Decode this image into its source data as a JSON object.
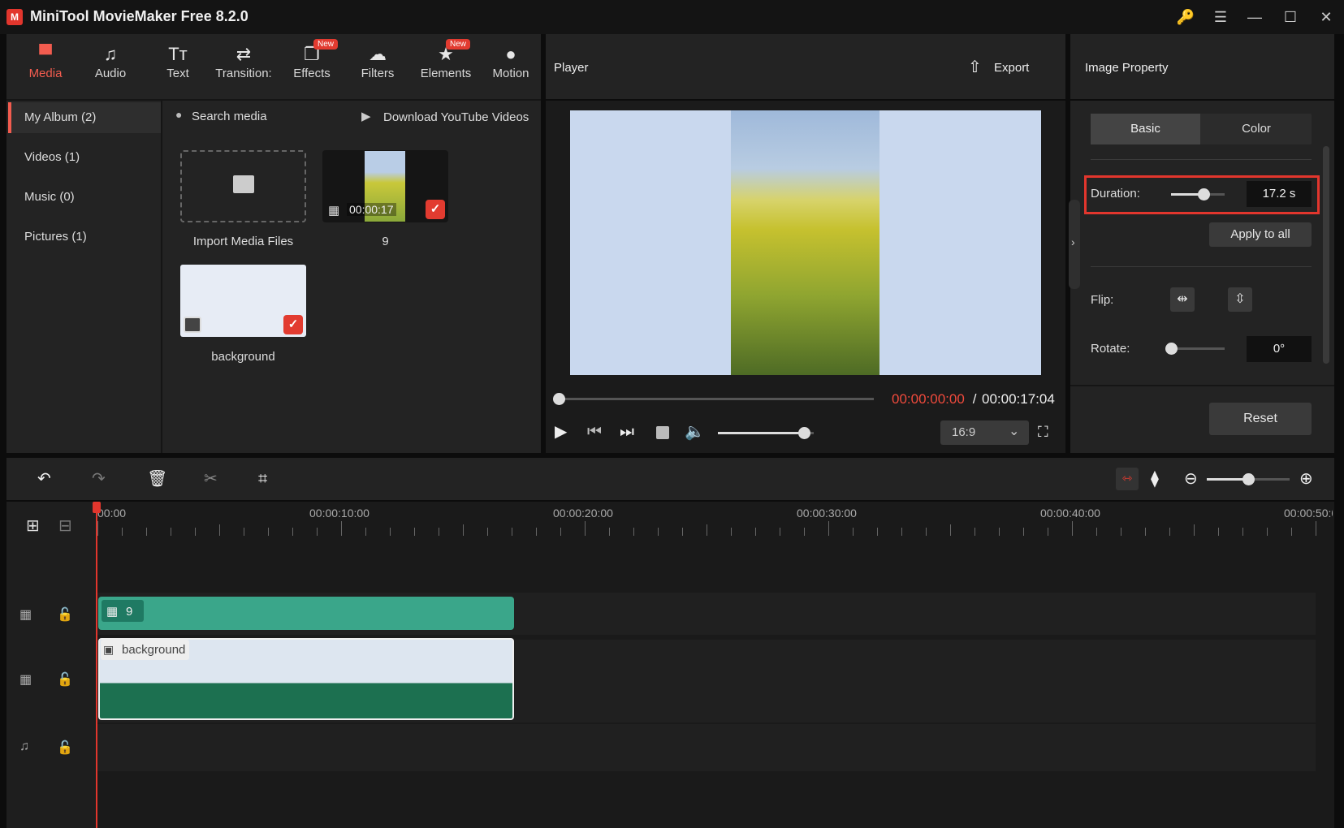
{
  "app": {
    "title": "MiniTool MovieMaker Free 8.2.0",
    "logo": "M"
  },
  "window_controls": {
    "key": "🔑",
    "menu": "☰",
    "minimize": "—",
    "maximize": "☐",
    "close": "✕"
  },
  "toolbar": {
    "items": [
      {
        "label": "Media",
        "icon": "media-icon",
        "glyph": "▀"
      },
      {
        "label": "Audio",
        "icon": "music-note-icon",
        "glyph": "♫"
      },
      {
        "label": "Text",
        "icon": "text-icon",
        "glyph": "Tт"
      },
      {
        "label": "Transition:",
        "icon": "transition-icon",
        "glyph": "⇄"
      },
      {
        "label": "Effects",
        "icon": "effects-icon",
        "glyph": "❐",
        "badge": "New"
      },
      {
        "label": "Filters",
        "icon": "filters-icon",
        "glyph": "☁"
      },
      {
        "label": "Elements",
        "icon": "elements-icon",
        "glyph": "★",
        "badge": "New"
      },
      {
        "label": "Motion",
        "icon": "motion-icon",
        "glyph": "●"
      }
    ]
  },
  "album": {
    "items": [
      "My Album (2)",
      "Videos (1)",
      "Music (0)",
      "Pictures (1)"
    ]
  },
  "media": {
    "search": "Search media",
    "download": "Download YouTube Videos",
    "import_label": "Import Media Files",
    "clip_duration": "00:00:17",
    "clip_name": "9",
    "background_name": "background"
  },
  "player": {
    "title": "Player",
    "export": "Export",
    "current_time": "00:00:00:00",
    "separator": " / ",
    "total_time": "00:00:17:04",
    "aspect": "16:9",
    "volume_level": 0.9,
    "progress": 0.0
  },
  "property": {
    "title": "Image Property",
    "tabs": [
      "Basic",
      "Color"
    ],
    "duration_label": "Duration:",
    "duration_value": "17.2 s",
    "apply_all": "Apply to all",
    "flip_label": "Flip:",
    "rotate_label": "Rotate:",
    "rotate_value": "0°",
    "reset": "Reset",
    "duration_slider": 0.6,
    "rotate_slider": 0.0
  },
  "timeline": {
    "ruler": [
      "00:00",
      "00:00:10:00",
      "00:00:20:00",
      "00:00:30:00",
      "00:00:40:00",
      "00:00:50:0"
    ],
    "video_clip": "9",
    "image_clip": "background",
    "zoom_level": 0.5
  },
  "colors": {
    "accent": "#f25c4f",
    "clip_video": "#3aa68a",
    "clip_image_bottom": "#1c7050",
    "clip_image_top": "#dde6f0",
    "highlight": "#e23b30"
  }
}
